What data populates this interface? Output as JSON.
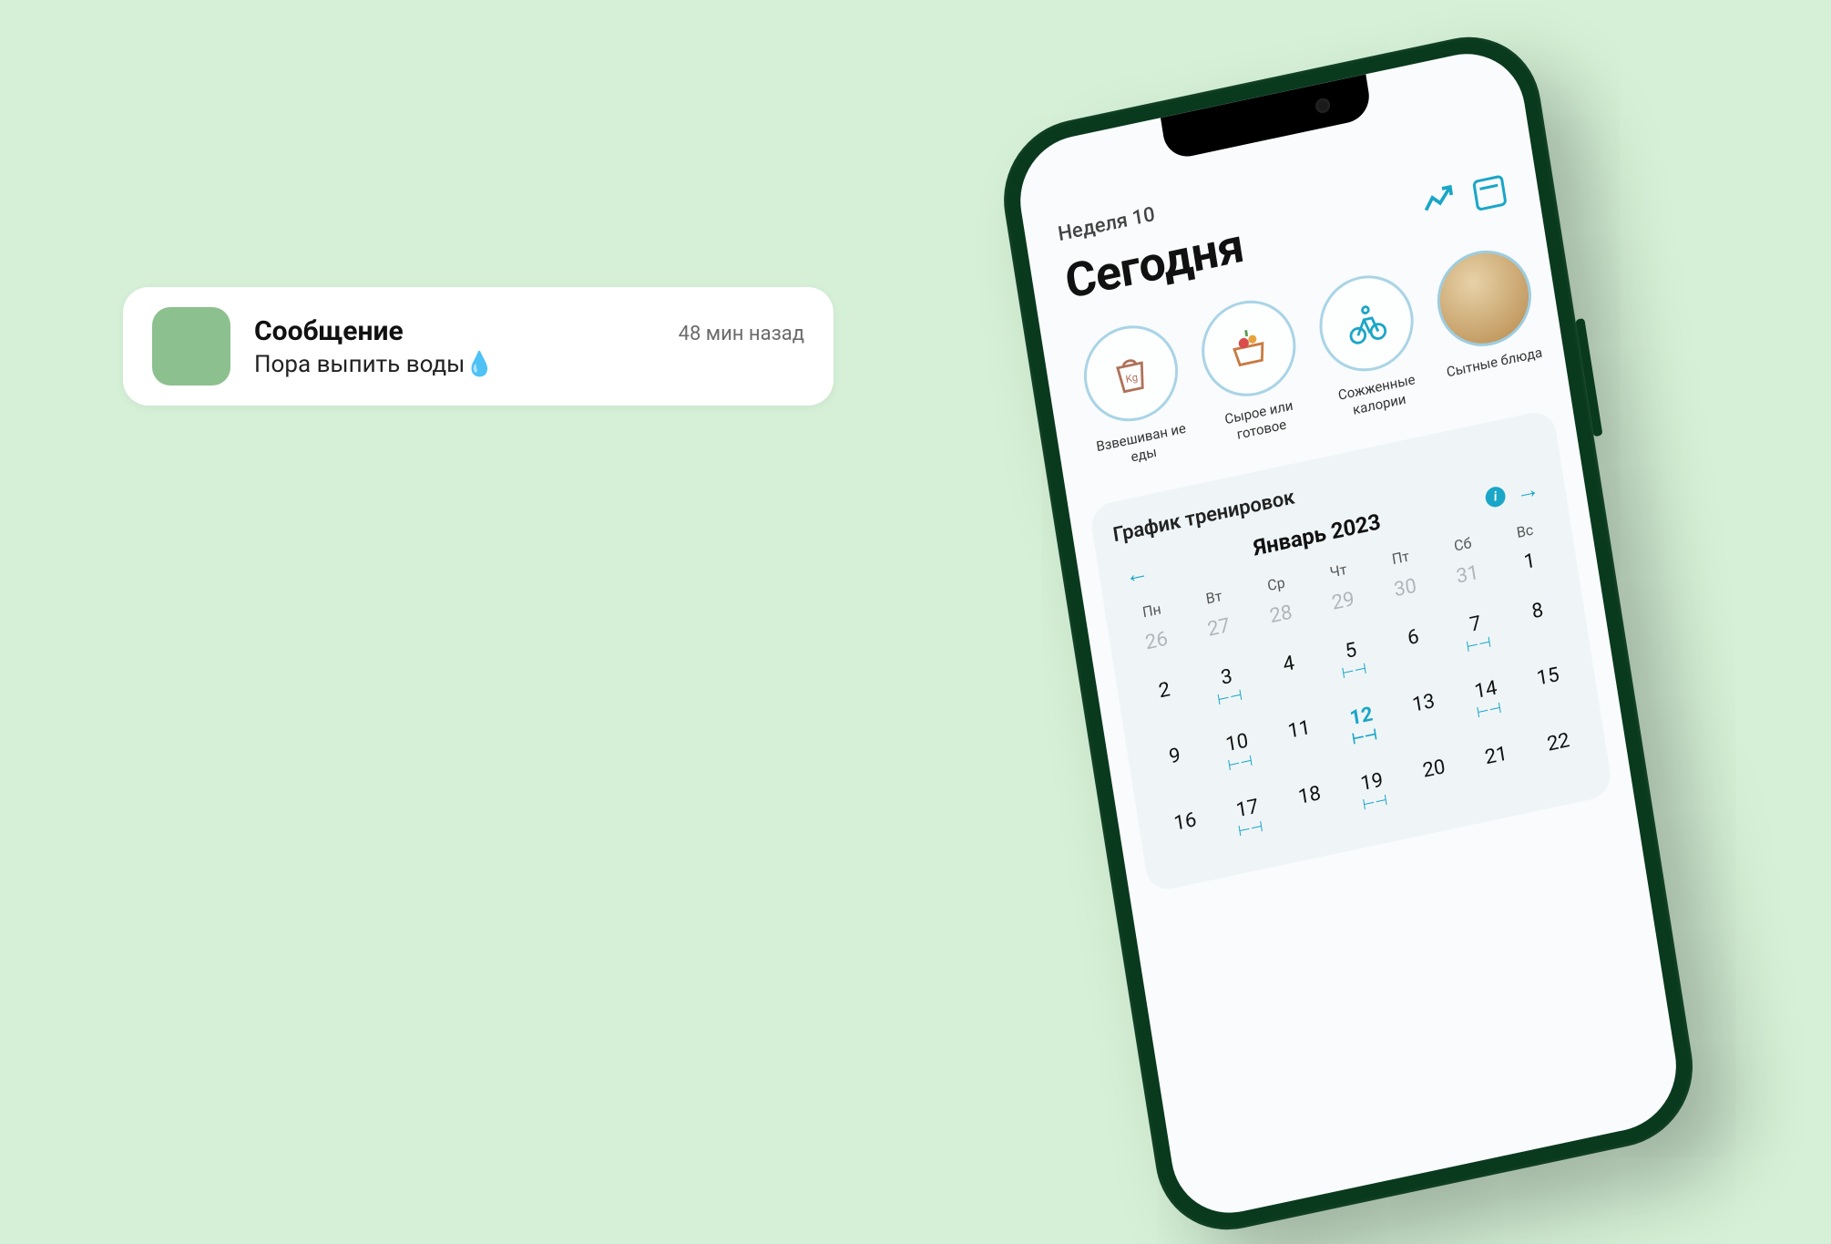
{
  "notification": {
    "title": "Сообщение",
    "time": "48 мин назад",
    "body": "Пора выпить воды💧",
    "icon_color": "#8cc08f"
  },
  "app": {
    "week_label": "Неделя 10",
    "screen_title": "Сегодня",
    "stories": [
      {
        "label": "Взвешиван ие еды",
        "icon": "bag"
      },
      {
        "label": "Сырое или готовое",
        "icon": "basket"
      },
      {
        "label": "Сожженные калории",
        "icon": "bike"
      },
      {
        "label": "Сытные блюда",
        "icon": "bowl"
      }
    ],
    "calendar": {
      "section_title": "График тренировок",
      "month": "Январь 2023",
      "dow": [
        "Пн",
        "Вт",
        "Ср",
        "Чт",
        "Пт",
        "Сб",
        "Вс"
      ],
      "rows": [
        [
          {
            "n": "26",
            "muted": true
          },
          {
            "n": "27",
            "muted": true
          },
          {
            "n": "28",
            "muted": true
          },
          {
            "n": "29",
            "muted": true
          },
          {
            "n": "30",
            "muted": true
          },
          {
            "n": "31",
            "muted": true
          },
          {
            "n": "1"
          }
        ],
        [
          {
            "n": "2"
          },
          {
            "n": "3",
            "wk": true
          },
          {
            "n": "4"
          },
          {
            "n": "5",
            "wk": true
          },
          {
            "n": "6"
          },
          {
            "n": "7",
            "wk": true
          },
          {
            "n": "8"
          }
        ],
        [
          {
            "n": "9"
          },
          {
            "n": "10",
            "wk": true
          },
          {
            "n": "11"
          },
          {
            "n": "12",
            "sel": true,
            "wk": true
          },
          {
            "n": "13"
          },
          {
            "n": "14",
            "wk": true
          },
          {
            "n": "15"
          }
        ],
        [
          {
            "n": "16"
          },
          {
            "n": "17",
            "wk": true
          },
          {
            "n": "18"
          },
          {
            "n": "19",
            "wk": true
          },
          {
            "n": "20"
          },
          {
            "n": "21"
          },
          {
            "n": "22"
          }
        ]
      ]
    },
    "accent": "#1aa6c7"
  }
}
